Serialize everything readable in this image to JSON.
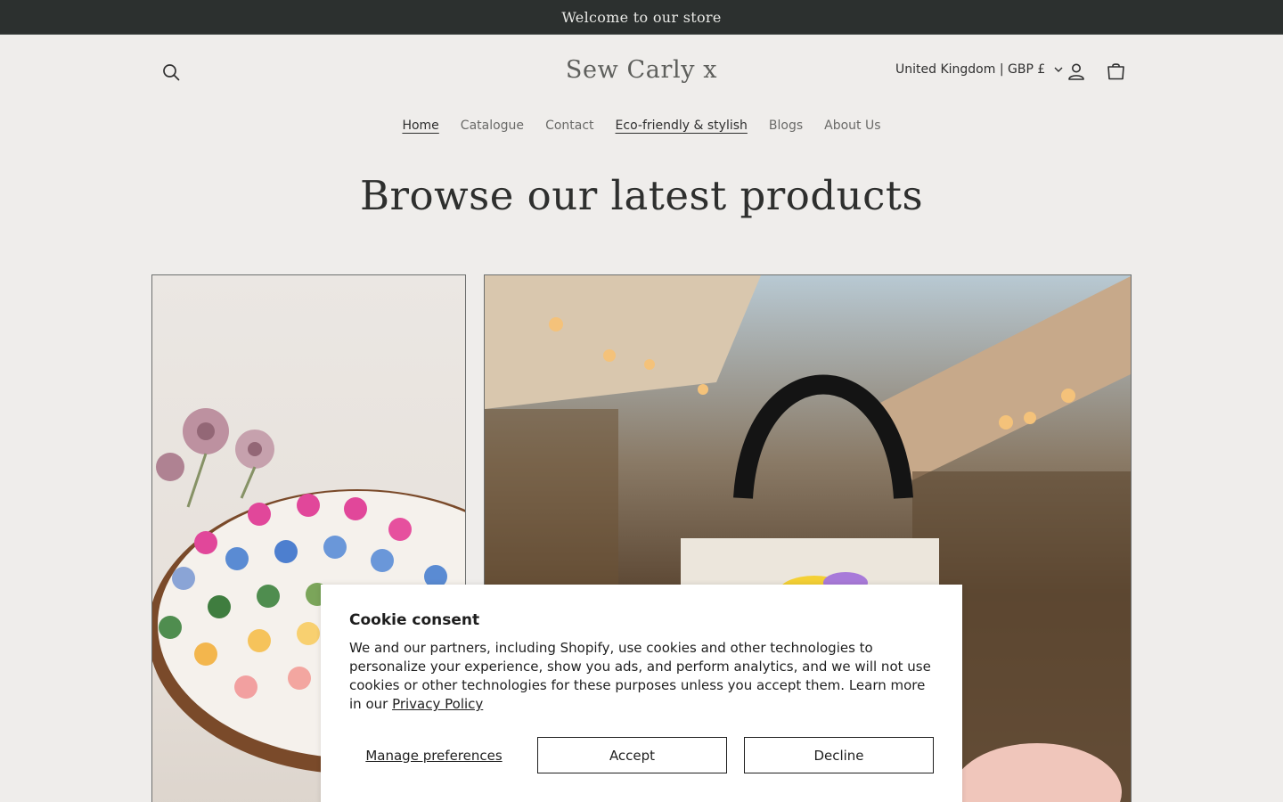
{
  "announcement": {
    "text": "Welcome to our store"
  },
  "header": {
    "logo": "Sew Carly x",
    "country_selector": "United Kingdom | GBP £",
    "icons": {
      "search": "search-icon",
      "account": "account-icon",
      "cart": "cart-icon",
      "dropdown": "chevron-down-icon"
    }
  },
  "nav": {
    "items": [
      {
        "label": "Home"
      },
      {
        "label": "Catalogue"
      },
      {
        "label": "Contact"
      },
      {
        "label": "Eco-friendly & stylish"
      },
      {
        "label": "Blogs"
      },
      {
        "label": "About Us"
      }
    ]
  },
  "main": {
    "headline": "Browse our latest products"
  },
  "cookie": {
    "title": "Cookie consent",
    "body": "We and our partners, including Shopify, use cookies and other technologies to personalize your experience, show you ads, and perform analytics, and we will not use cookies or other technologies for these purposes unless you accept them. Learn more in our ",
    "privacy_link": "Privacy Policy",
    "manage_label": "Manage preferences",
    "accept_label": "Accept",
    "decline_label": "Decline"
  },
  "colors": {
    "announcement_bg": "#2c302f",
    "page_bg": "#efedeb",
    "text": "#2b2b2b"
  }
}
